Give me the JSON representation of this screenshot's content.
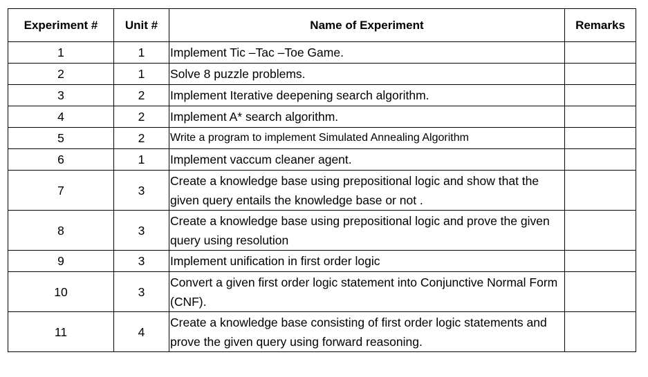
{
  "table": {
    "headers": {
      "experiment": "Experiment #",
      "unit": "Unit #",
      "name": "Name of Experiment",
      "remarks": "Remarks"
    },
    "rows": [
      {
        "experiment": "1",
        "unit": "1",
        "name": "Implement Tic –Tac –Toe Game.",
        "remarks": ""
      },
      {
        "experiment": "2",
        "unit": "1",
        "name": "Solve 8 puzzle problems.",
        "remarks": ""
      },
      {
        "experiment": "3",
        "unit": "2",
        "name": "Implement Iterative deepening search algorithm.",
        "remarks": ""
      },
      {
        "experiment": "4",
        "unit": "2",
        "name": "Implement A* search algorithm.",
        "remarks": ""
      },
      {
        "experiment": "5",
        "unit": "2",
        "name": "Write a program to implement Simulated Annealing Algorithm",
        "remarks": ""
      },
      {
        "experiment": "6",
        "unit": "1",
        "name": "Implement vaccum cleaner agent.",
        "remarks": ""
      },
      {
        "experiment": "7",
        "unit": "3",
        "name": "Create a knowledge base using prepositional logic and show that the given query entails the knowledge base or not .",
        "remarks": ""
      },
      {
        "experiment": "8",
        "unit": "3",
        "name": "Create a knowledge base using prepositional logic and prove the given query using resolution",
        "remarks": ""
      },
      {
        "experiment": "9",
        "unit": "3",
        "name": "Implement unification in first order logic",
        "remarks": ""
      },
      {
        "experiment": "10",
        "unit": "3",
        "name": "Convert a given first order logic statement into Conjunctive Normal Form (CNF).",
        "remarks": ""
      },
      {
        "experiment": "11",
        "unit": "4",
        "name": "Create a knowledge base consisting of first order logic statements and prove the given query using forward reasoning.",
        "remarks": ""
      }
    ]
  }
}
